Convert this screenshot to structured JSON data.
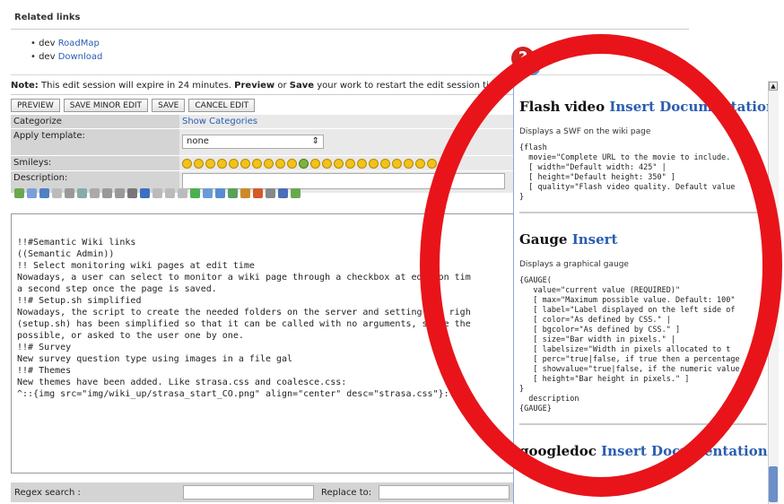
{
  "related_links": {
    "title": "Related links",
    "items": [
      {
        "prefix": "dev",
        "link": "RoadMap"
      },
      {
        "prefix": "dev",
        "link": "Download"
      }
    ]
  },
  "note": {
    "label": "Note:",
    "text_1": " This edit session will expire in 24 minutes. ",
    "preview_word": "Preview",
    "text_2": " or ",
    "save_word": "Save",
    "text_3": " your work to restart the edit session time"
  },
  "toolbar": {
    "preview": "PREVIEW",
    "save_minor": "SAVE MINOR EDIT",
    "save": "SAVE",
    "cancel": "CANCEL EDIT"
  },
  "form": {
    "categorize_label": "Categorize",
    "categorize_link": "Show Categories",
    "template_label": "Apply template:",
    "template_value": "none",
    "smileys_label": "Smileys:",
    "description_label": "Description:"
  },
  "editor_lines": [
    "",
    "!!#Semantic Wiki links",
    "((Semantic Admin))",
    "",
    "!! Select monitoring wiki pages at edit time",
    "Nowadays, a user can select to monitor a wiki page through a checkbox at edition tim",
    "a second step once the page is saved.",
    "",
    "!!# Setup.sh simplified",
    "Nowadays, the script to create the needed folders on the server and setting the righ",
    "(setup.sh) has been simplified so that it can be called with no arguments, since the",
    "possible, or asked to the user one by one.",
    "",
    "!!# Survey",
    "New survey question type using images in a file gal",
    "",
    "!!# Themes",
    "New themes have been added. Like strasa.css and coalesce.css:",
    "",
    "^::{img src=\"img/wiki_up/strasa_start_CO.png\" align=\"center\" desc=\"strasa.css\"}::^"
  ],
  "regex": {
    "search_label": "Regex search :",
    "replace_label": "Replace to:"
  },
  "help_pane": {
    "sections": [
      {
        "name": "Flash video",
        "links": "Insert Documentation",
        "description": "Displays a SWF on the wiki page",
        "code": [
          "{flash",
          "  movie=\"Complete URL to the movie to include.",
          "  [ width=\"Default width: 425\" |",
          "  [ height=\"Default height: 350\" ]",
          "  [ quality=\"Flash video quality. Default value",
          "}"
        ]
      },
      {
        "name": "Gauge",
        "links": "Insert",
        "description": "Displays a graphical gauge",
        "code": [
          "{GAUGE(",
          "   value=\"current value (REQUIRED)\"",
          "   [ max=\"Maximum possible value. Default: 100\"",
          "   [ label=\"Label displayed on the left side of",
          "   [ color=\"As defined by CSS.\" |",
          "   [ bgcolor=\"As defined by CSS.\" ]",
          "   [ size=\"Bar width in pixels.\" |",
          "   [ labelsize=\"Width in pixels allocated to t",
          "   [ perc=\"true|false, if true then a percentage",
          "   [ showvalue=\"true|false, if the numeric value",
          "   [ height=\"Bar height in pixels.\" ]",
          "}",
          "  description",
          "{GAUGE}"
        ]
      },
      {
        "name": "googledoc",
        "links": "Insert Documentation",
        "description": "",
        "code": []
      }
    ]
  },
  "help_icon": "?",
  "colors": {
    "highlight_ellipse": "#e8141a",
    "link": "#2a5db0",
    "label_bg": "#d4d4d4"
  }
}
